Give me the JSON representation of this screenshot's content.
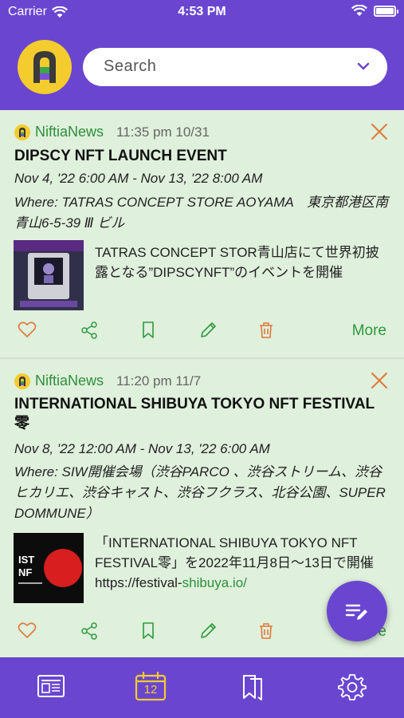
{
  "status": {
    "carrier": "Carrier",
    "time": "4:53 PM"
  },
  "search": {
    "placeholder": "Search"
  },
  "colors": {
    "accent": "#6a46d0",
    "card": "#dff0dc",
    "green": "#2e8f3a",
    "close": "#e0783a",
    "yellow": "#f5cc2e"
  },
  "posts": [
    {
      "source": "NiftiaNews",
      "timestamp": "11:35 pm 10/31",
      "title": "DIPSCY NFT LAUNCH EVENT",
      "dates": "Nov 4, '22 6:00 AM - Nov 13, '22 8:00 AM",
      "where": "Where: TATRAS CONCEPT STORE AOYAMA　東京都港区南青山6-5-39 Ⅲ ビル",
      "description": "TATRAS CONCEPT STOR青山店にて世界初披露となる”DIPSCYNFT”のイベントを開催",
      "more": "More"
    },
    {
      "source": "NiftiaNews",
      "timestamp": "11:20 pm 11/7",
      "title": "INTERNATIONAL SHIBUYA TOKYO NFT FESTIVAL 零",
      "dates": "Nov 8, '22 12:00 AM - Nov 13, '22 6:00 AM",
      "where": "Where: SIW開催会場（渋谷PARCO 、渋谷ストリーム、渋谷ヒカリエ、渋谷キャスト、渋谷フクラス、北谷公園、SUPER DOMMUNE）",
      "description": "「INTERNATIONAL SHIBUYA TOKYO NFT FESTIVAL零」を2022年11月8日～13日で開催",
      "link_prefix": "https://festival-",
      "link_highlight": "shibuya.io/",
      "more": "More"
    }
  ],
  "tabbar": {
    "calendar_day": "12"
  }
}
